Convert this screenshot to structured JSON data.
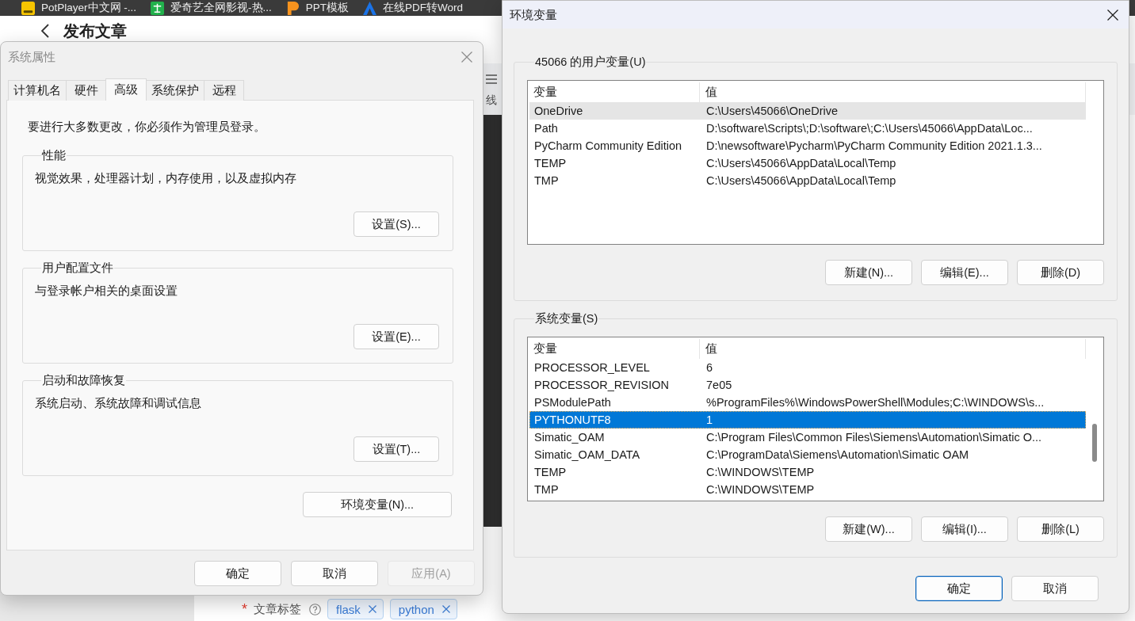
{
  "browser": {
    "bookmarks": [
      {
        "label": "PotPlayer中文网 -...",
        "kind": "tile"
      },
      {
        "label": "爱奇艺全网影视-热...",
        "kind": "square"
      },
      {
        "label": "PPT模板",
        "kind": "flag"
      },
      {
        "label": "在线PDF转Word",
        "kind": "triangle"
      }
    ]
  },
  "page": {
    "title": "发布文章",
    "toolbar_text": "线",
    "tag_field": {
      "required_mark": "*",
      "label": "文章标签",
      "tags": [
        {
          "label": "flask"
        },
        {
          "label": "python"
        }
      ]
    }
  },
  "system_properties": {
    "title": "系统属性",
    "active": false,
    "tabs": [
      {
        "label": "计算机名",
        "selected": false
      },
      {
        "label": "硬件",
        "selected": false
      },
      {
        "label": "高级",
        "selected": true
      },
      {
        "label": "系统保护",
        "selected": false
      },
      {
        "label": "远程",
        "selected": false
      }
    ],
    "notice": "要进行大多数更改，你必须作为管理员登录。",
    "groups": [
      {
        "title": "性能",
        "description": "视觉效果，处理器计划，内存使用，以及虚拟内存",
        "button": "设置(S)..."
      },
      {
        "title": "用户配置文件",
        "description": "与登录帐户相关的桌面设置",
        "button": "设置(E)..."
      },
      {
        "title": "启动和故障恢复",
        "description": "系统启动、系统故障和调试信息",
        "button": "设置(T)..."
      }
    ],
    "env_button": "环境变量(N)...",
    "buttons": [
      {
        "label": "确定",
        "disabled": false
      },
      {
        "label": "取消",
        "disabled": false
      },
      {
        "label": "应用(A)",
        "disabled": true
      }
    ]
  },
  "environment_variables": {
    "title": "环境变量",
    "active": true,
    "groups": [
      {
        "title": "45066 的用户变量(U)",
        "focused": false,
        "scrollable": false,
        "columns": [
          "变量",
          "值"
        ],
        "rows": [
          {
            "name": "OneDrive",
            "value": "C:\\Users\\45066\\OneDrive",
            "selected": true
          },
          {
            "name": "Path",
            "value": "D:\\software\\Scripts\\;D:\\software\\;C:\\Users\\45066\\AppData\\Loc...",
            "selected": false
          },
          {
            "name": "PyCharm Community Edition",
            "value": "D:\\newsoftware\\Pycharm\\PyCharm Community Edition 2021.1.3...",
            "selected": false
          },
          {
            "name": "TEMP",
            "value": "C:\\Users\\45066\\AppData\\Local\\Temp",
            "selected": false
          },
          {
            "name": "TMP",
            "value": "C:\\Users\\45066\\AppData\\Local\\Temp",
            "selected": false
          }
        ],
        "buttons": [
          "新建(N)...",
          "编辑(E)...",
          "删除(D)"
        ]
      },
      {
        "title": "系统变量(S)",
        "focused": true,
        "scrollable": true,
        "columns": [
          "变量",
          "值"
        ],
        "rows": [
          {
            "name": "PROCESSOR_LEVEL",
            "value": "6",
            "selected": false
          },
          {
            "name": "PROCESSOR_REVISION",
            "value": "7e05",
            "selected": false
          },
          {
            "name": "PSModulePath",
            "value": "%ProgramFiles%\\WindowsPowerShell\\Modules;C:\\WINDOWS\\s...",
            "selected": false
          },
          {
            "name": "PYTHONUTF8",
            "value": "1",
            "selected": true
          },
          {
            "name": "Simatic_OAM",
            "value": "C:\\Program Files\\Common Files\\Siemens\\Automation\\Simatic O...",
            "selected": false
          },
          {
            "name": "Simatic_OAM_DATA",
            "value": "C:\\ProgramData\\Siemens\\Automation\\Simatic OAM",
            "selected": false
          },
          {
            "name": "TEMP",
            "value": "C:\\WINDOWS\\TEMP",
            "selected": false
          },
          {
            "name": "TMP",
            "value": "C:\\WINDOWS\\TEMP",
            "selected": false
          }
        ],
        "buttons": [
          "新建(W)...",
          "编辑(I)...",
          "删除(L)"
        ]
      }
    ],
    "buttons": [
      {
        "label": "确定",
        "default": true
      },
      {
        "label": "取消",
        "default": false
      }
    ]
  }
}
